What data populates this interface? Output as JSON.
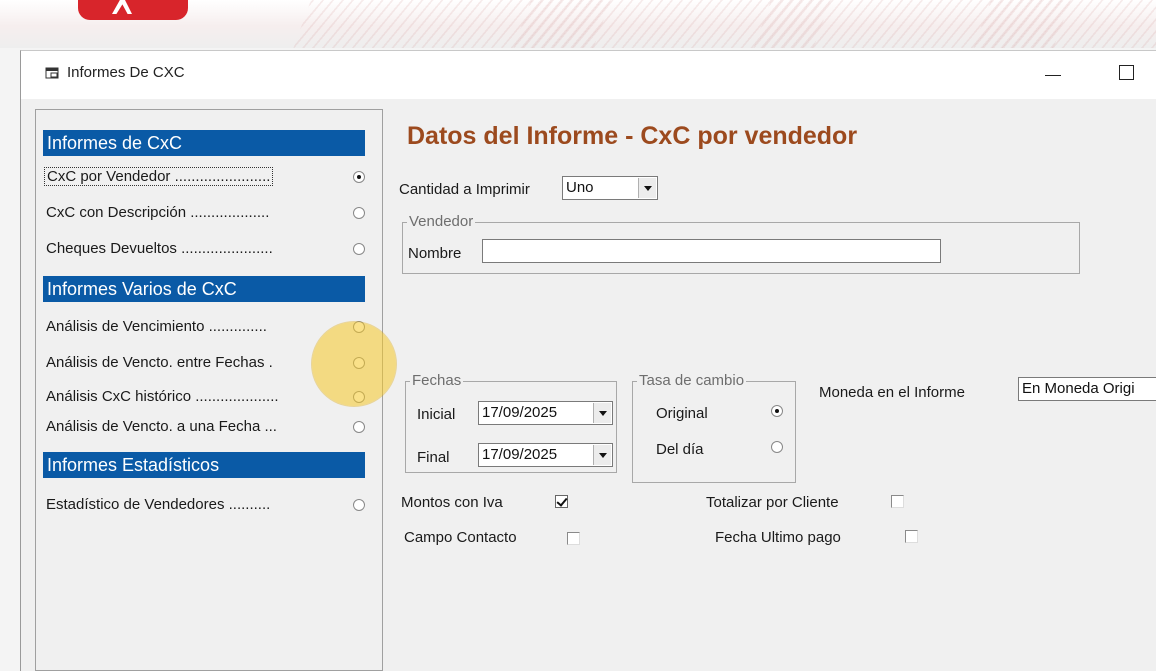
{
  "window": {
    "title": "Informes De CXC"
  },
  "left_panel": {
    "sections": [
      {
        "header": "Informes de CxC",
        "options": [
          {
            "label": "CxC por Vendedor .......................",
            "selected": true
          },
          {
            "label": "CxC con Descripción ...................",
            "selected": false
          },
          {
            "label": "Cheques Devueltos ......................",
            "selected": false
          }
        ]
      },
      {
        "header": "Informes Varios de CxC",
        "options": [
          {
            "label": "Análisis  de Vencimiento ..............",
            "selected": false
          },
          {
            "label": "Análisis  de Vencto. entre Fechas .",
            "selected": false
          },
          {
            "label": "Análisis CxC histórico ....................",
            "selected": false
          },
          {
            "label": "Análisis de Vencto. a una Fecha ...",
            "selected": false
          }
        ]
      },
      {
        "header": "Informes Estadísticos",
        "options": [
          {
            "label": "Estadístico de Vendedores ..........",
            "selected": false
          }
        ]
      }
    ]
  },
  "main": {
    "heading": "Datos del Informe - CxC por vendedor",
    "cantidad": {
      "label": "Cantidad a Imprimir",
      "value": "Uno"
    },
    "vendedor": {
      "group_title": "Vendedor",
      "nombre_label": "Nombre",
      "nombre_value": ""
    },
    "fechas": {
      "group_title": "Fechas",
      "inicial_label": "Inicial",
      "inicial_value": "17/09/2025",
      "final_label": "Final",
      "final_value": "17/09/2025"
    },
    "tasa": {
      "group_title": "Tasa de cambio",
      "original_label": "Original",
      "original_selected": true,
      "deldia_label": "Del día",
      "deldia_selected": false
    },
    "moneda": {
      "label": "Moneda en el Informe",
      "value": "En Moneda Origi"
    },
    "montos_iva": {
      "label": "Montos con Iva",
      "checked": true
    },
    "totalizar_cliente": {
      "label": "Totalizar por Cliente",
      "checked": false
    },
    "campo_contacto": {
      "label": "Campo Contacto",
      "checked": false
    },
    "fecha_ultimo_pago": {
      "label": "Fecha Ultimo pago",
      "checked": false
    }
  },
  "colors": {
    "section_header": "#0a5aa6",
    "heading": "#9c4a1e",
    "brand": "#d8252b"
  },
  "icons": [
    "app-window-icon",
    "minimize-icon",
    "maximize-icon",
    "dropdown-arrow-icon"
  ]
}
